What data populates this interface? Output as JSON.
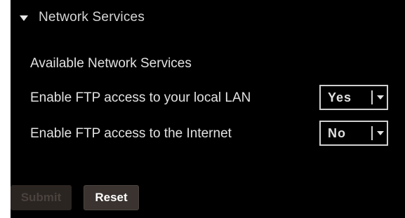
{
  "section": {
    "title": "Network Services",
    "expanded": true
  },
  "available_heading": "Available Network Services",
  "rows": [
    {
      "label": "Enable FTP access to your local LAN",
      "value": "Yes"
    },
    {
      "label": "Enable FTP access to the Internet",
      "value": "No"
    }
  ],
  "buttons": {
    "submit": "Submit",
    "reset": "Reset"
  }
}
